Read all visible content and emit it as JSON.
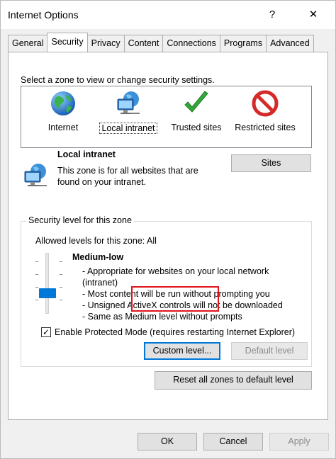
{
  "window": {
    "title": "Internet Options",
    "help_glyph": "?",
    "close_glyph": "✕"
  },
  "tabs": [
    "General",
    "Security",
    "Privacy",
    "Content",
    "Connections",
    "Programs",
    "Advanced"
  ],
  "active_tab": "Security",
  "zones": {
    "prompt": "Select a zone to view or change security settings.",
    "items": [
      {
        "label": "Internet",
        "icon": "globe-icon"
      },
      {
        "label": "Local intranet",
        "icon": "network-computer-icon",
        "selected": true
      },
      {
        "label": "Trusted sites",
        "icon": "checkmark-icon"
      },
      {
        "label": "Restricted sites",
        "icon": "prohibited-icon"
      }
    ]
  },
  "zone_info": {
    "name": "Local intranet",
    "description_lines": [
      "This zone is for all websites that are",
      "found on your intranet."
    ],
    "sites_button": "Sites"
  },
  "security_level": {
    "group_title": "Security level for this zone",
    "allowed": "Allowed levels for this zone: All",
    "level_name": "Medium-low",
    "description_lines": [
      "- Appropriate for websites on your local network",
      "(intranet)",
      "- Most content will be run without prompting you",
      "- Unsigned ActiveX controls will not be downloaded",
      "- Same as Medium level without prompts"
    ],
    "slider_level": "Medium-low",
    "protected_mode_label": "Enable Protected Mode (requires restarting Internet Explorer)",
    "protected_mode_checked": true,
    "checkmark_glyph": "✓",
    "custom_level_button": "Custom level...",
    "default_level_button": "Default level"
  },
  "reset_button": "Reset all zones to default level",
  "footer": {
    "ok": "OK",
    "cancel": "Cancel",
    "apply": "Apply"
  },
  "colors": {
    "highlight_outline": "#e0141b",
    "focus_border": "#0078d7",
    "slider_thumb": "#0078d7"
  }
}
